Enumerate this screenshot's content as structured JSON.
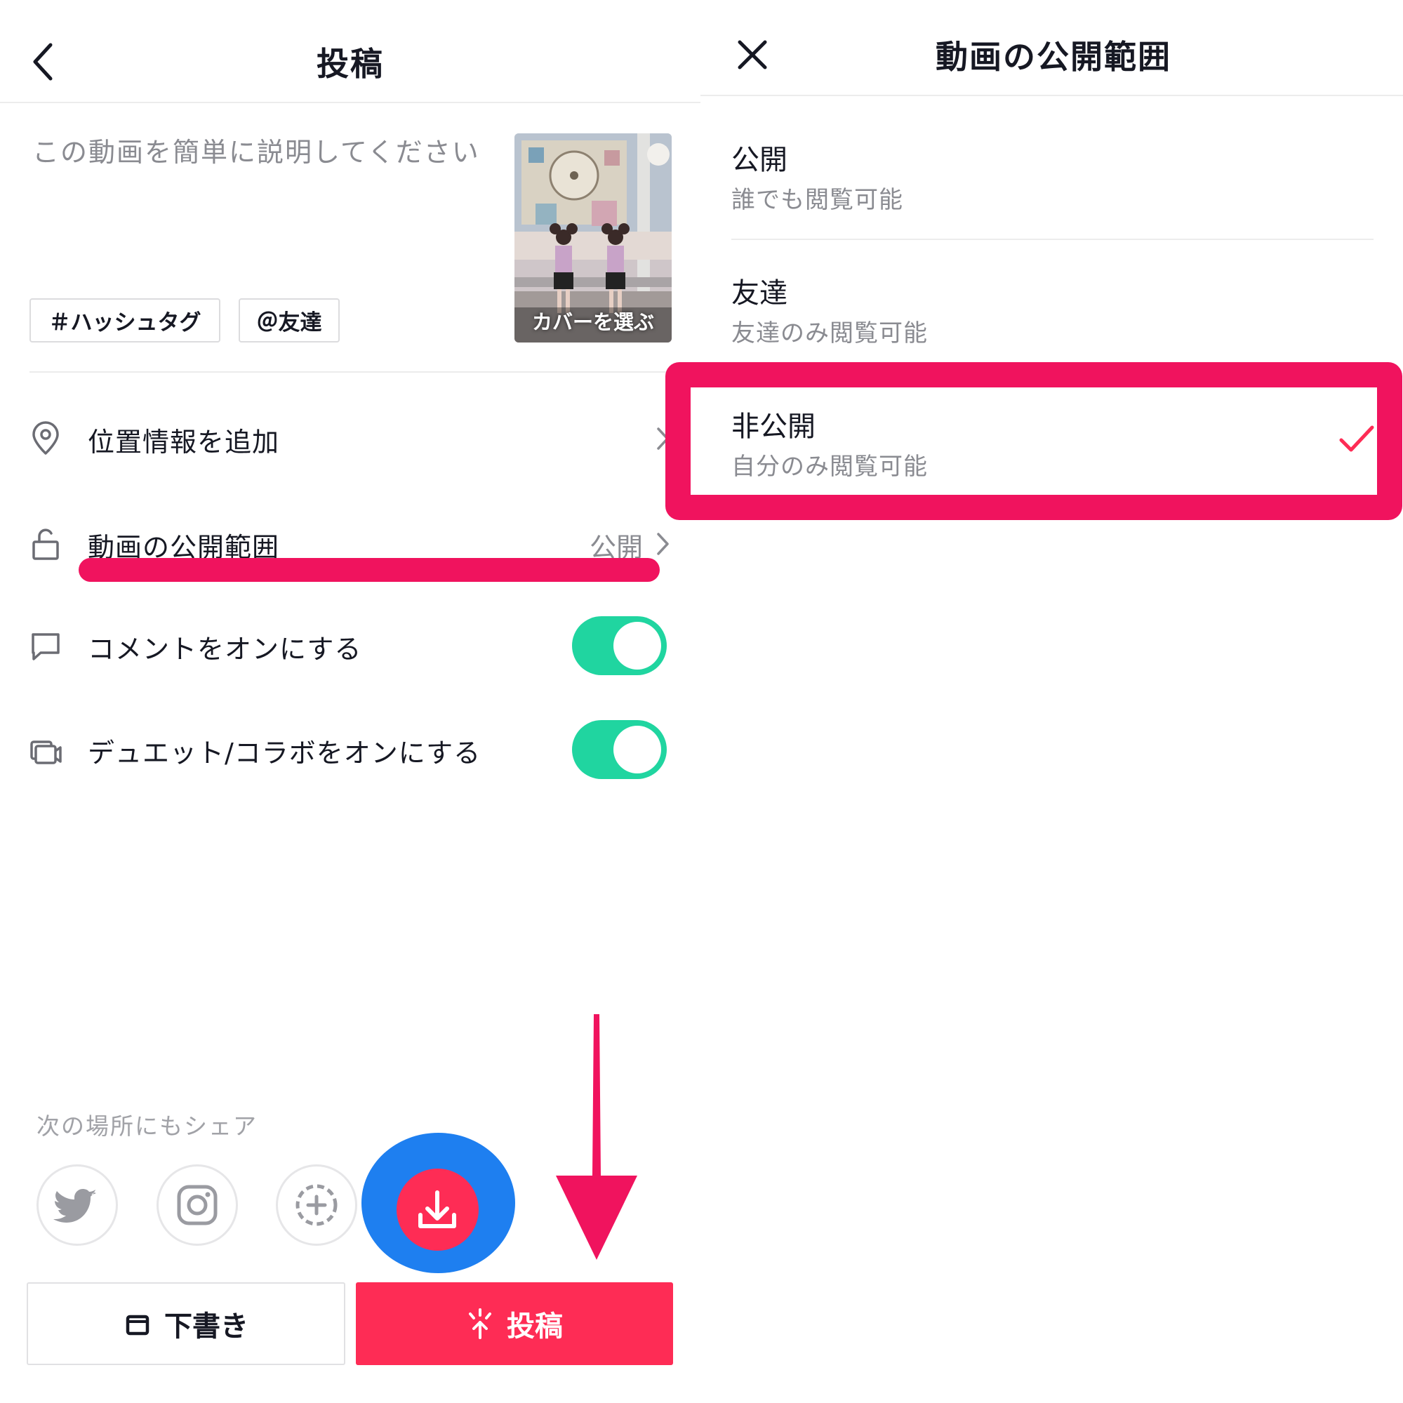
{
  "post_screen": {
    "title": "投稿",
    "description_placeholder": "この動画を簡単に説明してください",
    "cover_label": "カバーを選ぶ",
    "hashtag_chip": "＃ハッシュタグ",
    "friend_chip": "＠友達",
    "rows": {
      "location": "位置情報を追加",
      "privacy": "動画の公開範囲",
      "privacy_value": "公開",
      "comment": "コメントをオンにする",
      "duet": "デュエット/コラボをオンにする"
    },
    "toggles": {
      "comment_on": true,
      "duet_on": true
    },
    "share_label": "次の場所にもシェア",
    "share_targets": [
      "twitter-icon",
      "instagram-icon",
      "add-more-icon",
      "download-icon"
    ],
    "draft_button": "下書き",
    "post_button": "投稿"
  },
  "privacy_screen": {
    "title": "動画の公開範囲",
    "options": [
      {
        "title": "公開",
        "subtitle": "誰でも閲覧可能"
      },
      {
        "title": "友達",
        "subtitle": "友達のみ閲覧可能"
      },
      {
        "title": "非公開",
        "subtitle": "自分のみ閲覧可能"
      }
    ],
    "selected": "非公開"
  },
  "colors": {
    "accent": "#fe2c55",
    "toggle_on": "#20d5a0",
    "annotation": "#f0135e",
    "annotation_ring": "#1e7ff0",
    "text_primary": "#161823",
    "text_secondary": "#8a8b91"
  }
}
